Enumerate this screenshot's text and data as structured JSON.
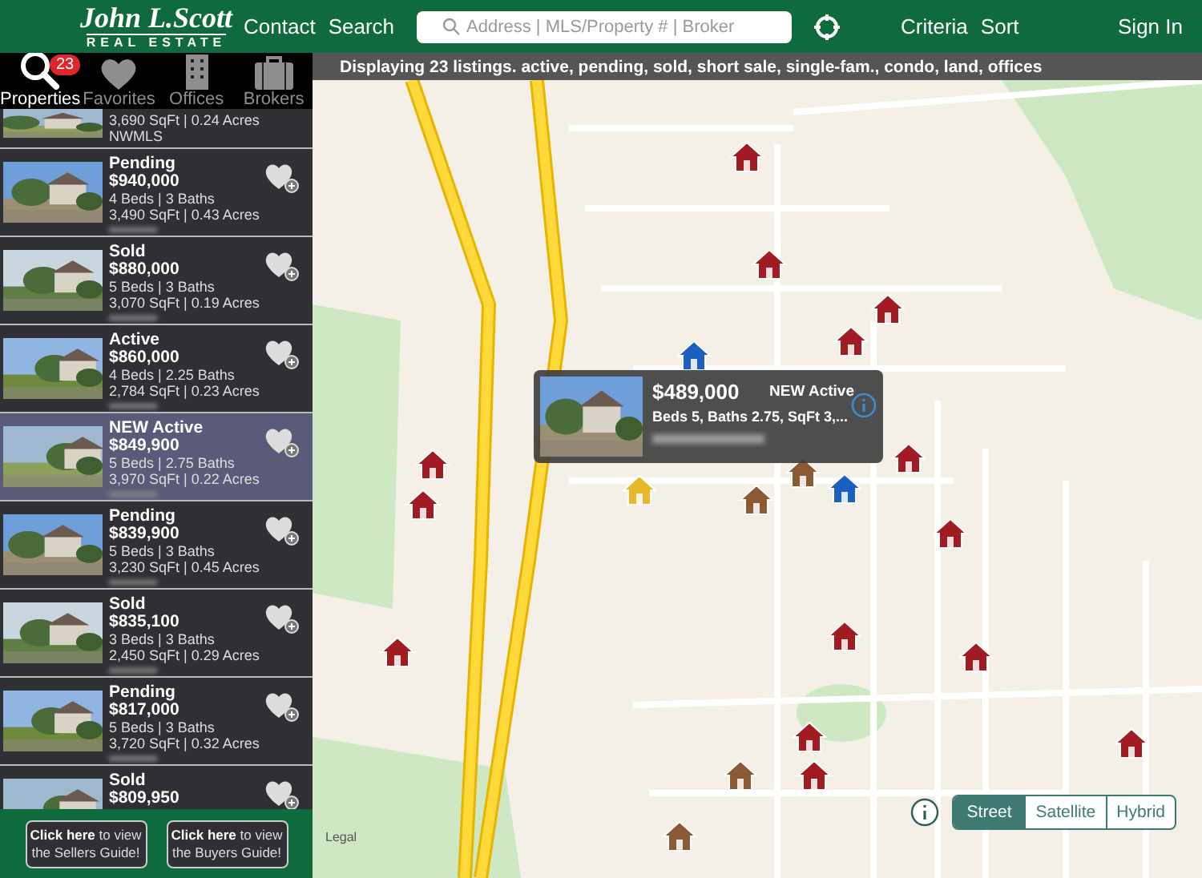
{
  "header": {
    "logo_name": "John L.Scott",
    "logo_sub": "REAL ESTATE",
    "links": [
      "Contact",
      "Search"
    ],
    "search": {
      "placeholder": "Address | MLS/Property # | Broker"
    },
    "right_links": [
      "Criteria",
      "Sort"
    ],
    "sign_in": "Sign In"
  },
  "tabs": [
    {
      "label": "Properties",
      "badge": "23",
      "selected": true
    },
    {
      "label": "Favorites",
      "selected": false
    },
    {
      "label": "Offices",
      "selected": false
    },
    {
      "label": "Brokers",
      "selected": false
    }
  ],
  "info_bar": "Displaying 23 listings. active, pending, sold, short sale, single-fam., condo, land, offices",
  "listings": [
    {
      "size": "3,690 SqFt | 0.24 Acres",
      "source": "NWMLS",
      "selected": false
    },
    {
      "status": "Pending",
      "price": "$940,000",
      "rooms": "4 Beds | 3 Baths",
      "size": "3,490 SqFt | 0.43 Acres",
      "selected": false
    },
    {
      "status": "Sold",
      "price": "$880,000",
      "rooms": "5 Beds | 3 Baths",
      "size": "3,070 SqFt | 0.19 Acres",
      "selected": false
    },
    {
      "status": "Active",
      "price": "$860,000",
      "rooms": "4 Beds | 2.25 Baths",
      "size": "2,784 SqFt | 0.23 Acres",
      "selected": false
    },
    {
      "status": "NEW  Active",
      "price": "$849,900",
      "rooms": "5 Beds | 2.75 Baths",
      "size": "3,970 SqFt | 0.22 Acres",
      "selected": true
    },
    {
      "status": "Pending",
      "price": "$839,900",
      "rooms": "5 Beds | 3 Baths",
      "size": "3,230 SqFt | 0.45 Acres",
      "selected": false
    },
    {
      "status": "Sold",
      "price": "$835,100",
      "rooms": "3 Beds | 3 Baths",
      "size": "2,450 SqFt | 0.29 Acres",
      "selected": false
    },
    {
      "status": "Pending",
      "price": "$817,000",
      "rooms": "5 Beds | 3 Baths",
      "size": "3,720 SqFt | 0.32 Acres",
      "selected": false
    },
    {
      "status": "Sold",
      "price": "$809,950",
      "selected": false
    }
  ],
  "guides": [
    {
      "bold": "Click here",
      "rest": " to view the Sellers Guide!"
    },
    {
      "bold": "Click here",
      "rest": " to view the Buyers Guide!"
    }
  ],
  "pins": [
    {
      "color": "#a01c22"
    },
    {
      "color": "#a01c22"
    },
    {
      "color": "#a01c22"
    },
    {
      "color": "#a01c22"
    },
    {
      "color": "#a01c22"
    },
    {
      "color": "#a01c22"
    },
    {
      "color": "#a01c22"
    },
    {
      "color": "#a01c22"
    },
    {
      "color": "#a01c22"
    },
    {
      "color": "#a01c22"
    },
    {
      "color": "#a01c22"
    },
    {
      "color": "#a01c22"
    },
    {
      "color": "#a01c22"
    },
    {
      "color": "#a01c22"
    },
    {
      "color": "#8a5a34"
    },
    {
      "color": "#8a5a34"
    },
    {
      "color": "#8a5a34"
    },
    {
      "color": "#8a5a34"
    },
    {
      "color": "#1c5fc0"
    },
    {
      "color": "#1c5fc0"
    }
  ],
  "popup": {
    "price": "$489,000",
    "status": "NEW Active",
    "details": "Beds 5, Baths 2.75, SqFt 3,..."
  },
  "legal": "Legal",
  "map_types": [
    {
      "label": "Street",
      "selected": true
    },
    {
      "label": "Satellite",
      "selected": false
    },
    {
      "label": "Hybrid",
      "selected": false
    }
  ]
}
